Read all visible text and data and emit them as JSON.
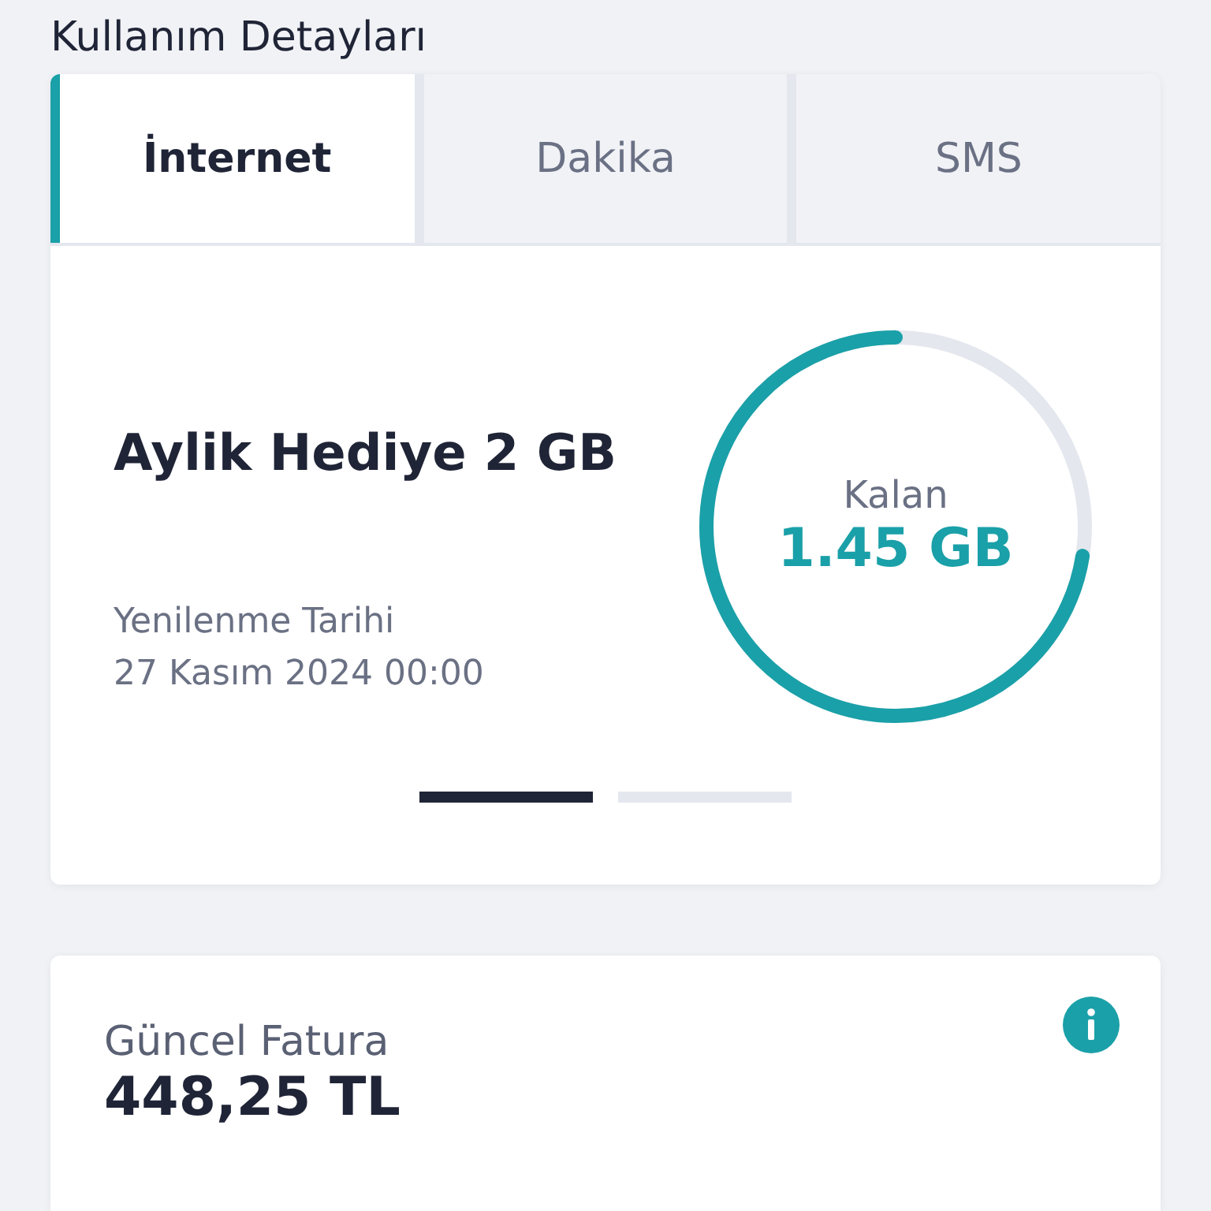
{
  "page_title": "Kullanım Detayları",
  "tabs": [
    {
      "label": "İnternet",
      "selected": true
    },
    {
      "label": "Dakika",
      "selected": false
    },
    {
      "label": "SMS",
      "selected": false
    }
  ],
  "package": {
    "name": "Aylik Hediye 2 GB",
    "renewal_label": "Yenilenme Tarihi",
    "renewal_date": "27 Kasım 2024 00:00",
    "gauge_label": "Kalan",
    "gauge_value": "1.45 GB",
    "level": 0.725
  },
  "pager": [
    {
      "selected": true
    },
    {
      "selected": false
    }
  ],
  "invoice": {
    "label": "Güncel Fatura",
    "amount": "448,25 TL"
  }
}
